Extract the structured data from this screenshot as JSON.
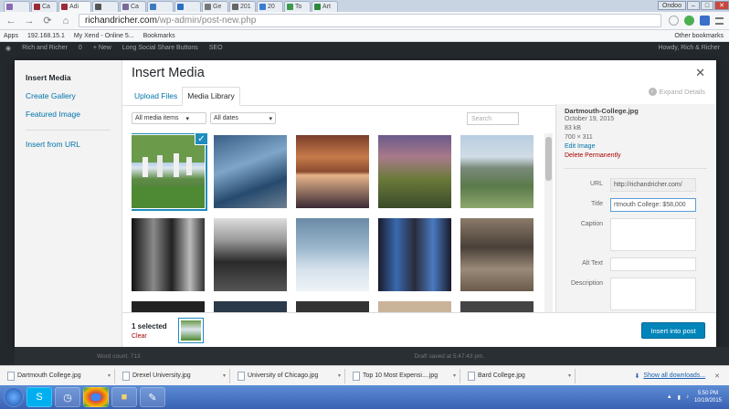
{
  "browser": {
    "tabs": [
      "",
      "Ca",
      "Adi",
      "",
      "Ca",
      "",
      "",
      "Ge",
      "201",
      "20",
      "To",
      "Art"
    ],
    "profile": "Ondoo",
    "min": "–",
    "max": "□",
    "close": "✕",
    "url_domain": "richandricher.com",
    "url_path": "/wp-admin/post-new.php"
  },
  "bookmarks": [
    "Apps",
    "192.168.15.1",
    "My Xend - Online 5...",
    "Bookmarks"
  ],
  "bookmarks_other": "Other bookmarks",
  "wpbar": {
    "site": "Rich and Richer",
    "comments": "0",
    "new": "+ New",
    "plugin": "Long Social Share Buttons",
    "seo": "SEO",
    "howdy": "Howdy, Rich & Richer"
  },
  "modal": {
    "title": "Insert Media",
    "menu": [
      "Insert Media",
      "Create Gallery",
      "Featured Image",
      "Insert from URL"
    ],
    "tabs": [
      "Upload Files",
      "Media Library"
    ],
    "expand_details": "Expand Details",
    "filter_type": "All media items",
    "filter_date": "All dates",
    "search_placeholder": "Search"
  },
  "details": {
    "filename": "Dartmouth-College.jpg",
    "date": "October 19, 2015",
    "size": "83 kB",
    "dimensions": "700 × 311",
    "edit_image": "Edit Image",
    "delete": "Delete Permanently",
    "labels": {
      "url": "URL",
      "title": "Title",
      "caption": "Caption",
      "alt": "Alt Text",
      "description": "Description"
    },
    "url_value": "http://richandricher.com/",
    "title_value": "rtmouth College: $58,000"
  },
  "toolbar": {
    "selected": "1 selected",
    "clear": "Clear",
    "insert": "Insert into post"
  },
  "under": {
    "left": "Word count: 713",
    "right": "Draft saved at 5:47:43 pm."
  },
  "downloads": [
    "Dartmouth College.jpg",
    "Drexel University.jpg",
    "University of Chicago.jpg",
    "Top 10 Most Expensi....jpg",
    "Bard College.jpg"
  ],
  "downloads_show_all": "Show all downloads...",
  "taskbar": {
    "time": "5:50 PM",
    "date": "10/19/2015"
  },
  "icons": {
    "back": "←",
    "forward": "→",
    "reload": "⟳",
    "home": "⌂",
    "close": "✕",
    "expand": "‹",
    "dropdown": "▾",
    "check": "✓",
    "caret": "▾",
    "download": "⬇"
  }
}
